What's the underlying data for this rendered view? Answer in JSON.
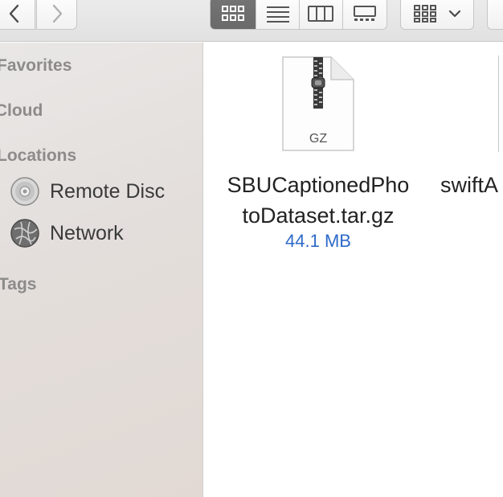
{
  "toolbar": {
    "back_icon": "chevron-left-icon",
    "forward_icon": "chevron-right-icon",
    "views": [
      "icon-view",
      "list-view",
      "column-view",
      "gallery-view"
    ],
    "active_view": "icon-view"
  },
  "sidebar": {
    "favorites": "Favorites",
    "icloud": "iCloud",
    "locations": "Locations",
    "remote_disc": "Remote Disc",
    "network": "Network",
    "tags": "Tags"
  },
  "files": [
    {
      "name_line1": "SBUCaptionedPho",
      "name_line2": "toDataset.tar.gz",
      "size": "44.1 MB",
      "icon_label": "GZ"
    },
    {
      "name_line1": "swiftA"
    }
  ],
  "colors": {
    "accent": "#2d6ac9",
    "active_segment": "#6f6f6f"
  }
}
